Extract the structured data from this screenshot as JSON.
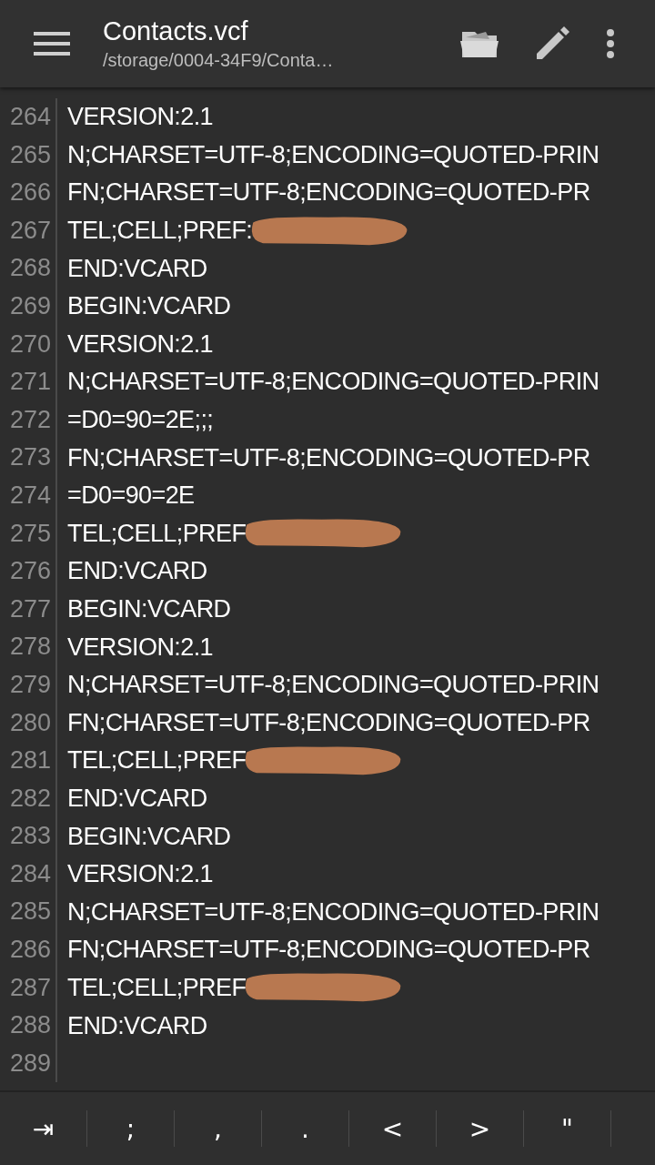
{
  "app_bar": {
    "title": "Contacts.vcf",
    "subtitle": "/storage/0004-34F9/Conta…"
  },
  "editor": {
    "lines": [
      {
        "number": "264",
        "text": "VERSION:2.1"
      },
      {
        "number": "265",
        "text": "N;CHARSET=UTF-8;ENCODING=QUOTED-PRIN"
      },
      {
        "number": "266",
        "text": "FN;CHARSET=UTF-8;ENCODING=QUOTED-PR"
      },
      {
        "number": "267",
        "text": "TEL;CELL;PREF:",
        "redacted": true
      },
      {
        "number": "268",
        "text": "END:VCARD"
      },
      {
        "number": "269",
        "text": "BEGIN:VCARD"
      },
      {
        "number": "270",
        "text": "VERSION:2.1"
      },
      {
        "number": "271",
        "text": "N;CHARSET=UTF-8;ENCODING=QUOTED-PRIN"
      },
      {
        "number": "272",
        "text": "=D0=90=2E;;;"
      },
      {
        "number": "273",
        "text": "FN;CHARSET=UTF-8;ENCODING=QUOTED-PR"
      },
      {
        "number": "274",
        "text": "=D0=90=2E"
      },
      {
        "number": "275",
        "text": "TEL;CELL;PREF",
        "redacted": true
      },
      {
        "number": "276",
        "text": "END:VCARD"
      },
      {
        "number": "277",
        "text": "BEGIN:VCARD"
      },
      {
        "number": "278",
        "text": "VERSION:2.1"
      },
      {
        "number": "279",
        "text": "N;CHARSET=UTF-8;ENCODING=QUOTED-PRIN"
      },
      {
        "number": "280",
        "text": "FN;CHARSET=UTF-8;ENCODING=QUOTED-PR"
      },
      {
        "number": "281",
        "text": "TEL;CELL;PREF",
        "redacted": true
      },
      {
        "number": "282",
        "text": "END:VCARD"
      },
      {
        "number": "283",
        "text": "BEGIN:VCARD"
      },
      {
        "number": "284",
        "text": "VERSION:2.1"
      },
      {
        "number": "285",
        "text": "N;CHARSET=UTF-8;ENCODING=QUOTED-PRIN"
      },
      {
        "number": "286",
        "text": "FN;CHARSET=UTF-8;ENCODING=QUOTED-PR"
      },
      {
        "number": "287",
        "text": "TEL;CELL;PREF",
        "redacted": true
      },
      {
        "number": "288",
        "text": "END:VCARD"
      },
      {
        "number": "289"
      }
    ]
  },
  "symbol_bar": {
    "keys": [
      "⇥",
      ";",
      ",",
      ".",
      "<",
      ">",
      "\""
    ]
  }
}
